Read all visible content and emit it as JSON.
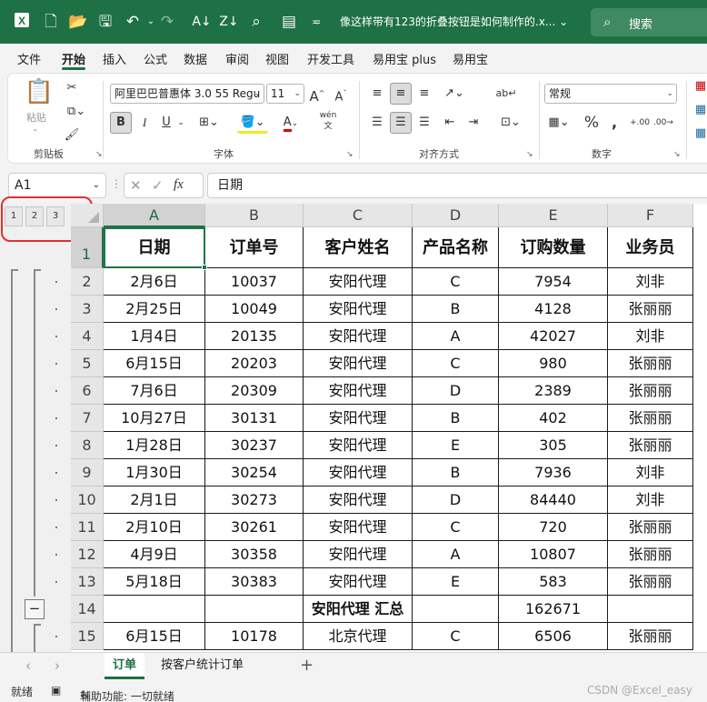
{
  "titlebar": {
    "doc_title": "像这样带有123的折叠按钮是如何制作的.x...",
    "search_label": "搜索"
  },
  "menu": [
    "文件",
    "开始",
    "插入",
    "公式",
    "数据",
    "审阅",
    "视图",
    "开发工具",
    "易用宝 plus",
    "易用宝"
  ],
  "menu_active": "开始",
  "ribbon": {
    "paste_label": "粘贴",
    "clipboard_label": "剪贴板",
    "font_name": "阿里巴巴普惠体 3.0 55 Regu",
    "font_size": "11",
    "font_group_label": "字体",
    "bold": "B",
    "italic": "I",
    "underline": "U",
    "align_group_label": "对齐方式",
    "number_format": "常规",
    "number_group_label": "数字",
    "grow_font": "A",
    "shrink_font": "A",
    "font_color_letter": "A",
    "wen": "wén",
    "wen2": "文"
  },
  "formula_bar": {
    "name_box": "A1",
    "fx": "fx",
    "formula": "日期"
  },
  "outline_levels": [
    "1",
    "2",
    "3"
  ],
  "columns": [
    "A",
    "B",
    "C",
    "D",
    "E",
    "F"
  ],
  "table": {
    "header": [
      "日期",
      "订单号",
      "客户姓名",
      "产品名称",
      "订购数量",
      "业务员"
    ],
    "rows": [
      {
        "n": "2",
        "cells": [
          "2月6日",
          "10037",
          "安阳代理",
          "C",
          "7954",
          "刘非"
        ]
      },
      {
        "n": "3",
        "cells": [
          "2月25日",
          "10049",
          "安阳代理",
          "B",
          "4128",
          "张丽丽"
        ]
      },
      {
        "n": "4",
        "cells": [
          "1月4日",
          "20135",
          "安阳代理",
          "A",
          "42027",
          "刘非"
        ]
      },
      {
        "n": "5",
        "cells": [
          "6月15日",
          "20203",
          "安阳代理",
          "C",
          "980",
          "张丽丽"
        ]
      },
      {
        "n": "6",
        "cells": [
          "7月6日",
          "20309",
          "安阳代理",
          "D",
          "2389",
          "张丽丽"
        ]
      },
      {
        "n": "7",
        "cells": [
          "10月27日",
          "30131",
          "安阳代理",
          "B",
          "402",
          "张丽丽"
        ]
      },
      {
        "n": "8",
        "cells": [
          "1月28日",
          "30237",
          "安阳代理",
          "E",
          "305",
          "张丽丽"
        ]
      },
      {
        "n": "9",
        "cells": [
          "1月30日",
          "30254",
          "安阳代理",
          "B",
          "7936",
          "刘非"
        ]
      },
      {
        "n": "10",
        "cells": [
          "2月1日",
          "30273",
          "安阳代理",
          "D",
          "84440",
          "刘非"
        ]
      },
      {
        "n": "11",
        "cells": [
          "2月10日",
          "30261",
          "安阳代理",
          "C",
          "720",
          "张丽丽"
        ]
      },
      {
        "n": "12",
        "cells": [
          "4月9日",
          "30358",
          "安阳代理",
          "A",
          "10807",
          "张丽丽"
        ]
      },
      {
        "n": "13",
        "cells": [
          "5月18日",
          "30383",
          "安阳代理",
          "E",
          "583",
          "张丽丽"
        ]
      },
      {
        "n": "14",
        "cells": [
          "",
          "",
          "安阳代理 汇总",
          "",
          "162671",
          ""
        ],
        "subtotal": true
      },
      {
        "n": "15",
        "cells": [
          "6月15日",
          "10178",
          "北京代理",
          "C",
          "6506",
          "张丽丽"
        ]
      }
    ]
  },
  "header_row_num": "1",
  "sheets": [
    "订单",
    "按客户统计订单"
  ],
  "active_sheet": "订单",
  "status": {
    "ready": "就绪",
    "accessibility": "辅助功能: 一切就绪"
  },
  "watermark": "CSDN @Excel_easy",
  "colors": {
    "accent": "#1e7145",
    "highlight": "#e03030"
  }
}
